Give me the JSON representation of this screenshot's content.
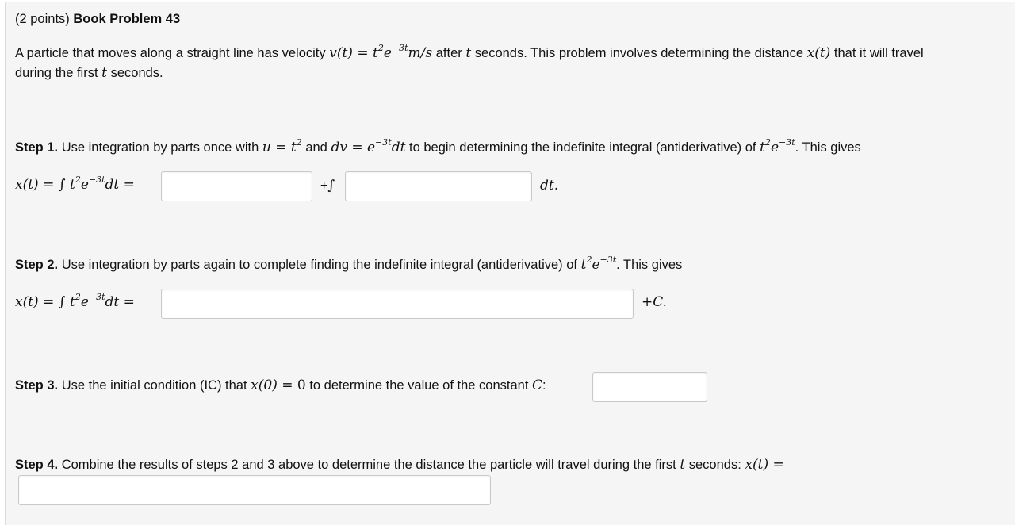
{
  "header": {
    "points": "(2 points)",
    "title": "Book Problem 43"
  },
  "intro": {
    "text1": "A particle that moves along a straight line has velocity",
    "text2": "after",
    "text3": "seconds. This problem involves determining the distance",
    "text4": "that it will travel",
    "text5": "during the first",
    "text6": "seconds."
  },
  "step1": {
    "label": "Step 1.",
    "text1": "Use integration by parts once with",
    "text2": "and",
    "text3": "to begin determining the indefinite integral (antiderivative) of",
    "text4": ". This gives",
    "input1": "",
    "plus": "+",
    "input2": "",
    "suffix": "dt."
  },
  "step2": {
    "label": "Step 2.",
    "text1": "Use integration by parts again to complete finding the indefinite integral (antiderivative) of",
    "text2": ". This gives",
    "input": "",
    "suffix": "+C."
  },
  "step3": {
    "label": "Step 3.",
    "text1": "Use the initial condition (IC) that",
    "text2": "to determine the value of the constant",
    "input": ""
  },
  "step4": {
    "label": "Step 4.",
    "text1": "Combine the results of steps 2 and 3 above to determine the distance the particle will travel during the first",
    "text2": "seconds:",
    "input": ""
  }
}
